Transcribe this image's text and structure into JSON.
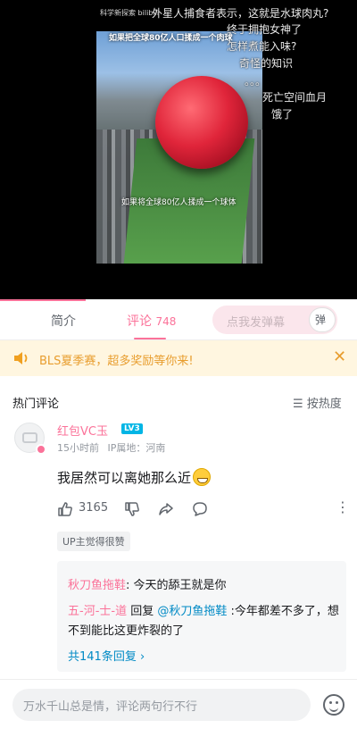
{
  "video": {
    "watermark": "科学新探索 bilibili",
    "caption_top": "如果把全球80亿人口揉成一个肉球",
    "caption_mid": "如果将全球80亿人揉成一个球体",
    "danmaku": [
      "外星人捕食者表示，这就是水球肉丸?",
      "终于拥抱女神了",
      "怎样煮能入味?",
      "奇怪的知识",
      "。。。",
      "死亡空间血月",
      "饿了"
    ]
  },
  "tabs": {
    "intro": "简介",
    "comments_label": "评论",
    "comments_count": "748",
    "danmu_placeholder": "点我发弹幕",
    "danmu_button": "弹"
  },
  "banner": {
    "text": "BLS夏季赛，超多奖励等你来!",
    "close": "✕"
  },
  "comments_header": {
    "title": "热门评论",
    "sort": "☰ 按热度"
  },
  "comment": {
    "username": "红包VC玉",
    "level": "LV3",
    "time": "15小时前",
    "location": "IP属地：河南",
    "text": "我居然可以离她那么近",
    "likes": "3165",
    "up_liked": "UP主觉得很赞",
    "replies": {
      "r1_user": "秋刀鱼拖鞋",
      "r1_text": ": 今天的舔王就是你",
      "r2_user": "五-河-士-道",
      "r2_reply": " 回复 ",
      "r2_mention": "@秋刀鱼拖鞋",
      "r2_text": " :今年都差不多了，想不到能比这更炸裂的了",
      "all": "共141条回复 ›"
    }
  },
  "bottom": {
    "placeholder": "万水千山总是情，评论两句行不行"
  },
  "colors": {
    "accent": "#fb7299",
    "link": "#008ac5",
    "banner_bg": "#fff6e0",
    "banner_text": "#e89d2e"
  }
}
